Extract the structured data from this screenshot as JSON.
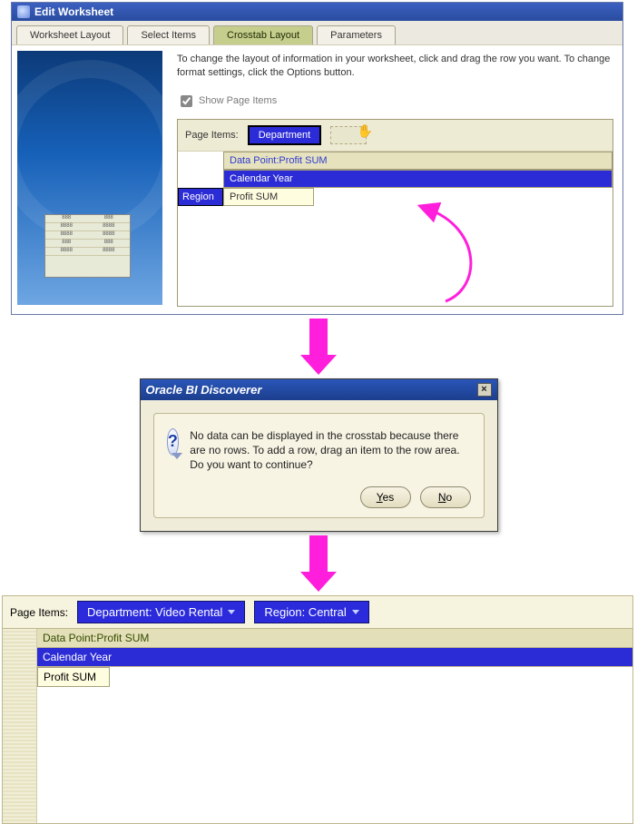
{
  "panel1": {
    "title": "Edit Worksheet",
    "tabs": [
      "Worksheet Layout",
      "Select Items",
      "Crosstab Layout",
      "Parameters"
    ],
    "active_tab_index": 2,
    "instructions": "To change the layout of information in your worksheet, click and drag the row you want. To change format settings, click the Options button.",
    "show_page_items_label": "Show Page Items",
    "show_page_items_checked": true,
    "page_items_label": "Page Items:",
    "page_pill": "Department",
    "data_point_label": "Data Point:Profit SUM",
    "calendar_year_label": "Calendar Year",
    "region_label": "Region",
    "cell_value": "Profit SUM"
  },
  "dialog": {
    "title": "Oracle BI Discoverer",
    "message": "No data can be displayed in the crosstab because there are no rows. To add a row, drag an item to the row area. Do you want to continue?",
    "yes": "Yes",
    "no": "No"
  },
  "panel3": {
    "page_items_label": "Page Items:",
    "chip_department": "Department:  Video Rental",
    "chip_region": "Region:  Central",
    "data_point_label": "Data Point:Profit SUM",
    "calendar_year_label": "Calendar Year",
    "cell_value": "Profit SUM"
  }
}
